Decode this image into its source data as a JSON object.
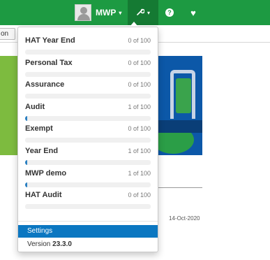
{
  "topbar": {
    "user_label": "MWP",
    "caret": "▾",
    "tools_icon": "wrench-icon",
    "help_icon": "question-circle-icon",
    "heart_icon": "heart-icon",
    "help_glyph": "?",
    "heart_glyph": "♥",
    "wrench_glyph": "🔧"
  },
  "background": {
    "button_label": "on",
    "date": "14-Oct-2020"
  },
  "dropdown": {
    "items": [
      {
        "name": "HAT Year End",
        "count": "0 of 100",
        "progress": 0
      },
      {
        "name": "Personal Tax",
        "count": "0 of 100",
        "progress": 0
      },
      {
        "name": "Assurance",
        "count": "0 of 100",
        "progress": 0
      },
      {
        "name": "Audit",
        "count": "1 of 100",
        "progress": 0.01
      },
      {
        "name": "Exempt",
        "count": "0 of 100",
        "progress": 0
      },
      {
        "name": "Year End",
        "count": "1 of 100",
        "progress": 0.01
      },
      {
        "name": "MWP demo",
        "count": "1 of 100",
        "progress": 0.01
      },
      {
        "name": "HAT Audit",
        "count": "0 of 100",
        "progress": 0
      }
    ],
    "settings_label": "Settings",
    "version_prefix": "Version",
    "version_number": "23.3.0"
  },
  "colors": {
    "topbar": "#1d9a42",
    "progress": "#2a7fc1",
    "settings_highlight": "#0b77c1"
  }
}
